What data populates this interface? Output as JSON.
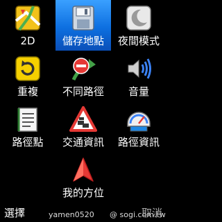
{
  "menu": {
    "items": [
      {
        "label": "2D",
        "icon": "map-2d-icon",
        "selected": false
      },
      {
        "label": "儲存地點",
        "icon": "save-disk-icon",
        "selected": true
      },
      {
        "label": "夜間模式",
        "icon": "moon-icon",
        "selected": false
      },
      {
        "label": "重複",
        "icon": "repeat-icon",
        "selected": false
      },
      {
        "label": "不同路徑",
        "icon": "no-entry-route-icon",
        "selected": false
      },
      {
        "label": "音量",
        "icon": "speaker-icon",
        "selected": false
      },
      {
        "label": "路徑點",
        "icon": "waypoint-list-icon",
        "selected": false
      },
      {
        "label": "交通資訊",
        "icon": "traffic-warning-icon",
        "selected": false
      },
      {
        "label": "路徑資訊",
        "icon": "speedometer-icon",
        "selected": false
      },
      {
        "label": "我的方位",
        "icon": "navigation-arrow-icon",
        "selected": false
      }
    ]
  },
  "softkeys": {
    "left": "選擇",
    "right": "取消"
  },
  "watermark": {
    "user": "yamen0520",
    "site": "@ sogi.com.tw"
  },
  "colors": {
    "selected_bg": "#1a7ff0",
    "background": "#000000"
  }
}
